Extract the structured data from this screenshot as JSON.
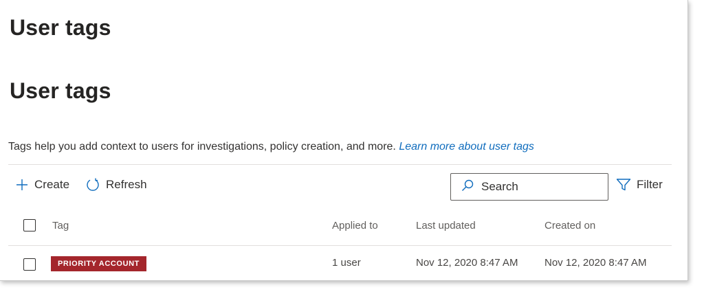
{
  "page": {
    "title": "User tags",
    "section_title": "User tags",
    "description": "Tags help you add context to users for investigations, policy creation, and more.",
    "learn_more_link": "Learn more about user tags"
  },
  "toolbar": {
    "create_label": "Create",
    "create_icon": "plus-icon",
    "refresh_label": "Refresh",
    "refresh_icon": "refresh-icon",
    "search_placeholder": "Search",
    "search_icon": "search-icon",
    "filter_label": "Filter",
    "filter_icon": "filter-icon"
  },
  "table": {
    "columns": [
      "Tag",
      "Applied to",
      "Last updated",
      "Created on"
    ],
    "rows": [
      {
        "tag": "PRIORITY ACCOUNT",
        "tag_color": "#a4262c",
        "applied_to": "1 user",
        "last_updated": "Nov 12, 2020 8:47 AM",
        "created_on": "Nov 12, 2020 8:47 AM"
      }
    ]
  },
  "colors": {
    "accent": "#0f6cbd",
    "tag_badge": "#a4262c",
    "text": "#323130"
  }
}
